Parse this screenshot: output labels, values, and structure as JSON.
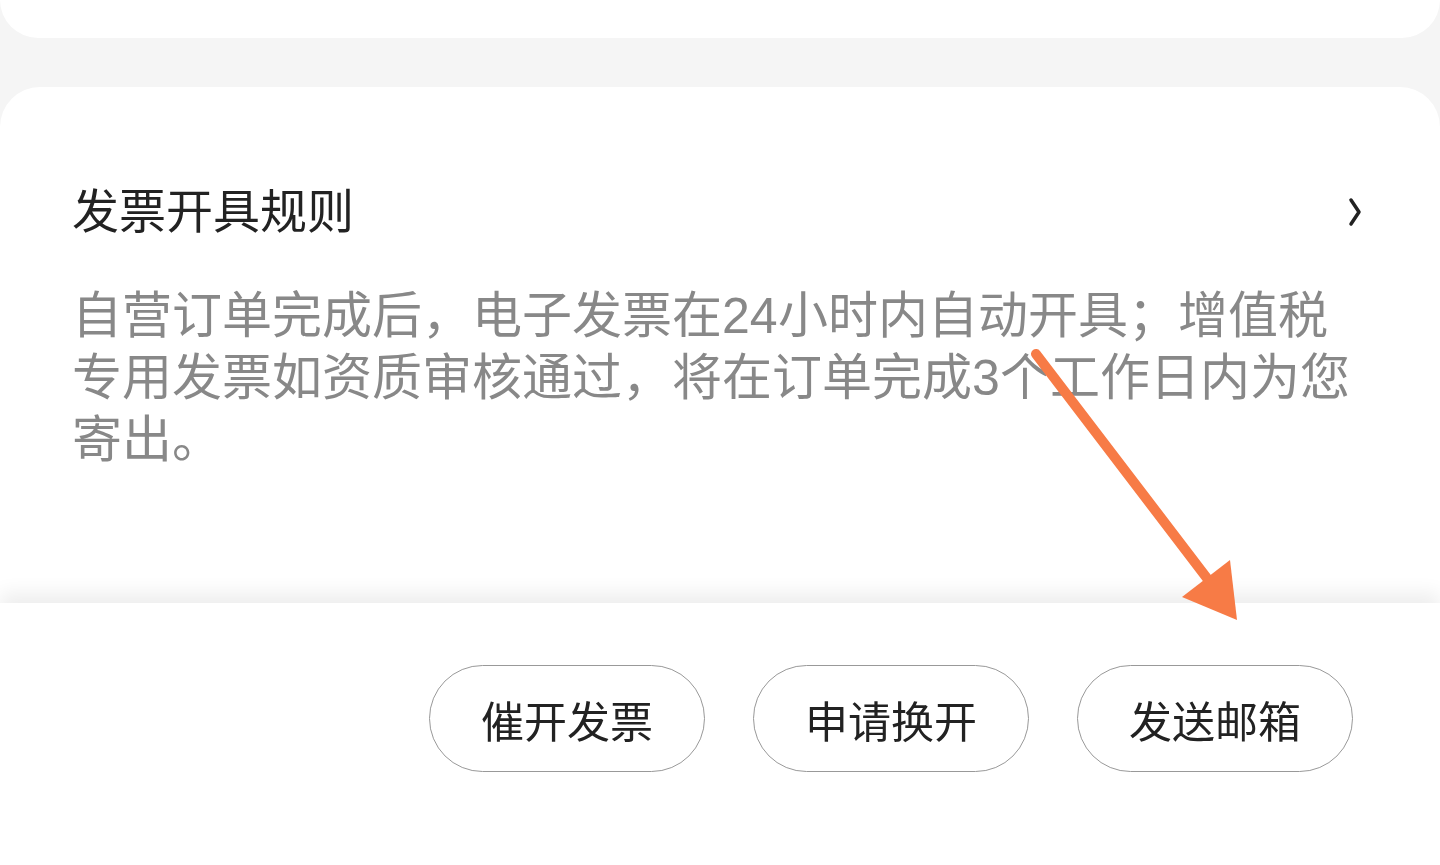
{
  "rules_section": {
    "title": "发票开具规则",
    "description": "自营订单完成后，电子发票在24小时内自动开具；增值税专用发票如资质审核通过，将在订单完成3个工作日内为您寄出。"
  },
  "actions": [
    {
      "label": "催开发票"
    },
    {
      "label": "申请换开"
    },
    {
      "label": "发送邮箱"
    }
  ]
}
